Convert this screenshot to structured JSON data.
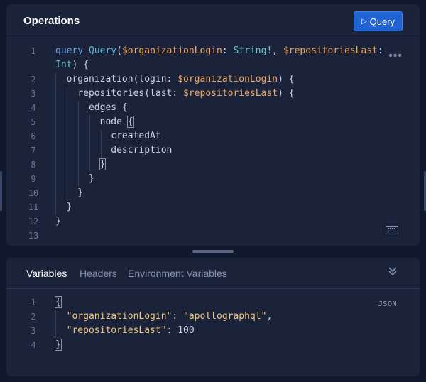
{
  "operations": {
    "title": "Operations",
    "query_button_label": "Query",
    "play_glyph": "▷",
    "more_glyph": "•••",
    "lines": [
      {
        "n": "1",
        "parts": [
          [
            "kw",
            "query"
          ],
          [
            "p",
            " "
          ],
          [
            "fn",
            "Query"
          ],
          [
            "p",
            "("
          ],
          [
            "var",
            "$organizationLogin"
          ],
          [
            "p",
            ": "
          ],
          [
            "type",
            "String!"
          ],
          [
            "p",
            ", "
          ],
          [
            "var",
            "$repositoriesLast"
          ],
          [
            "p",
            ":"
          ]
        ]
      },
      {
        "n": "",
        "parts": [
          [
            "type",
            "Int"
          ],
          [
            "p",
            ") {"
          ]
        ]
      },
      {
        "n": "2",
        "parts": [
          [
            "p",
            "  "
          ],
          [
            "field",
            "organization"
          ],
          [
            "p",
            "(login: "
          ],
          [
            "var",
            "$organizationLogin"
          ],
          [
            "p",
            ") {"
          ]
        ]
      },
      {
        "n": "3",
        "parts": [
          [
            "p",
            "    "
          ],
          [
            "field",
            "repositories"
          ],
          [
            "p",
            "(last: "
          ],
          [
            "var",
            "$repositoriesLast"
          ],
          [
            "p",
            ") {"
          ]
        ]
      },
      {
        "n": "4",
        "parts": [
          [
            "p",
            "      "
          ],
          [
            "field",
            "edges"
          ],
          [
            "p",
            " {"
          ]
        ]
      },
      {
        "n": "5",
        "parts": [
          [
            "p",
            "        "
          ],
          [
            "field",
            "node"
          ],
          [
            "p",
            " "
          ],
          [
            "hl",
            "{"
          ]
        ]
      },
      {
        "n": "6",
        "parts": [
          [
            "p",
            "          "
          ],
          [
            "field",
            "createdAt"
          ]
        ]
      },
      {
        "n": "7",
        "parts": [
          [
            "p",
            "          "
          ],
          [
            "field",
            "description"
          ]
        ]
      },
      {
        "n": "8",
        "parts": [
          [
            "p",
            "        "
          ],
          [
            "hl",
            "}"
          ]
        ]
      },
      {
        "n": "9",
        "parts": [
          [
            "p",
            "      }"
          ]
        ]
      },
      {
        "n": "10",
        "parts": [
          [
            "p",
            "    }"
          ]
        ]
      },
      {
        "n": "11",
        "parts": [
          [
            "p",
            "  }"
          ]
        ]
      },
      {
        "n": "12",
        "parts": [
          [
            "p",
            "}"
          ]
        ]
      },
      {
        "n": "13",
        "parts": []
      }
    ]
  },
  "variables": {
    "tabs": [
      "Variables",
      "Headers",
      "Environment Variables"
    ],
    "active_tab": 0,
    "format_label": "JSON",
    "lines": [
      {
        "n": "1",
        "parts": [
          [
            "hl",
            "{"
          ]
        ]
      },
      {
        "n": "2",
        "parts": [
          [
            "p",
            "  "
          ],
          [
            "str",
            "\"organizationLogin\""
          ],
          [
            "p",
            ": "
          ],
          [
            "str",
            "\"apollographql\""
          ],
          [
            "p",
            ","
          ]
        ]
      },
      {
        "n": "3",
        "parts": [
          [
            "p",
            "  "
          ],
          [
            "str",
            "\"repositoriesLast\""
          ],
          [
            "p",
            ": "
          ],
          [
            "num",
            "100"
          ]
        ]
      },
      {
        "n": "4",
        "parts": [
          [
            "hl",
            "}"
          ]
        ]
      }
    ]
  },
  "icons": {
    "run": "play-icon",
    "more": "more-icon",
    "keyboard": "keyboard-icon",
    "collapse": "chevron-double-down-icon"
  },
  "colors": {
    "background": "#10182d",
    "panel": "#1a2339",
    "accent_button": "#1f64d2",
    "keyword": "#6ea2ec",
    "variable": "#f2a65e",
    "type": "#6ec7c9",
    "string": "#f2c97d"
  }
}
